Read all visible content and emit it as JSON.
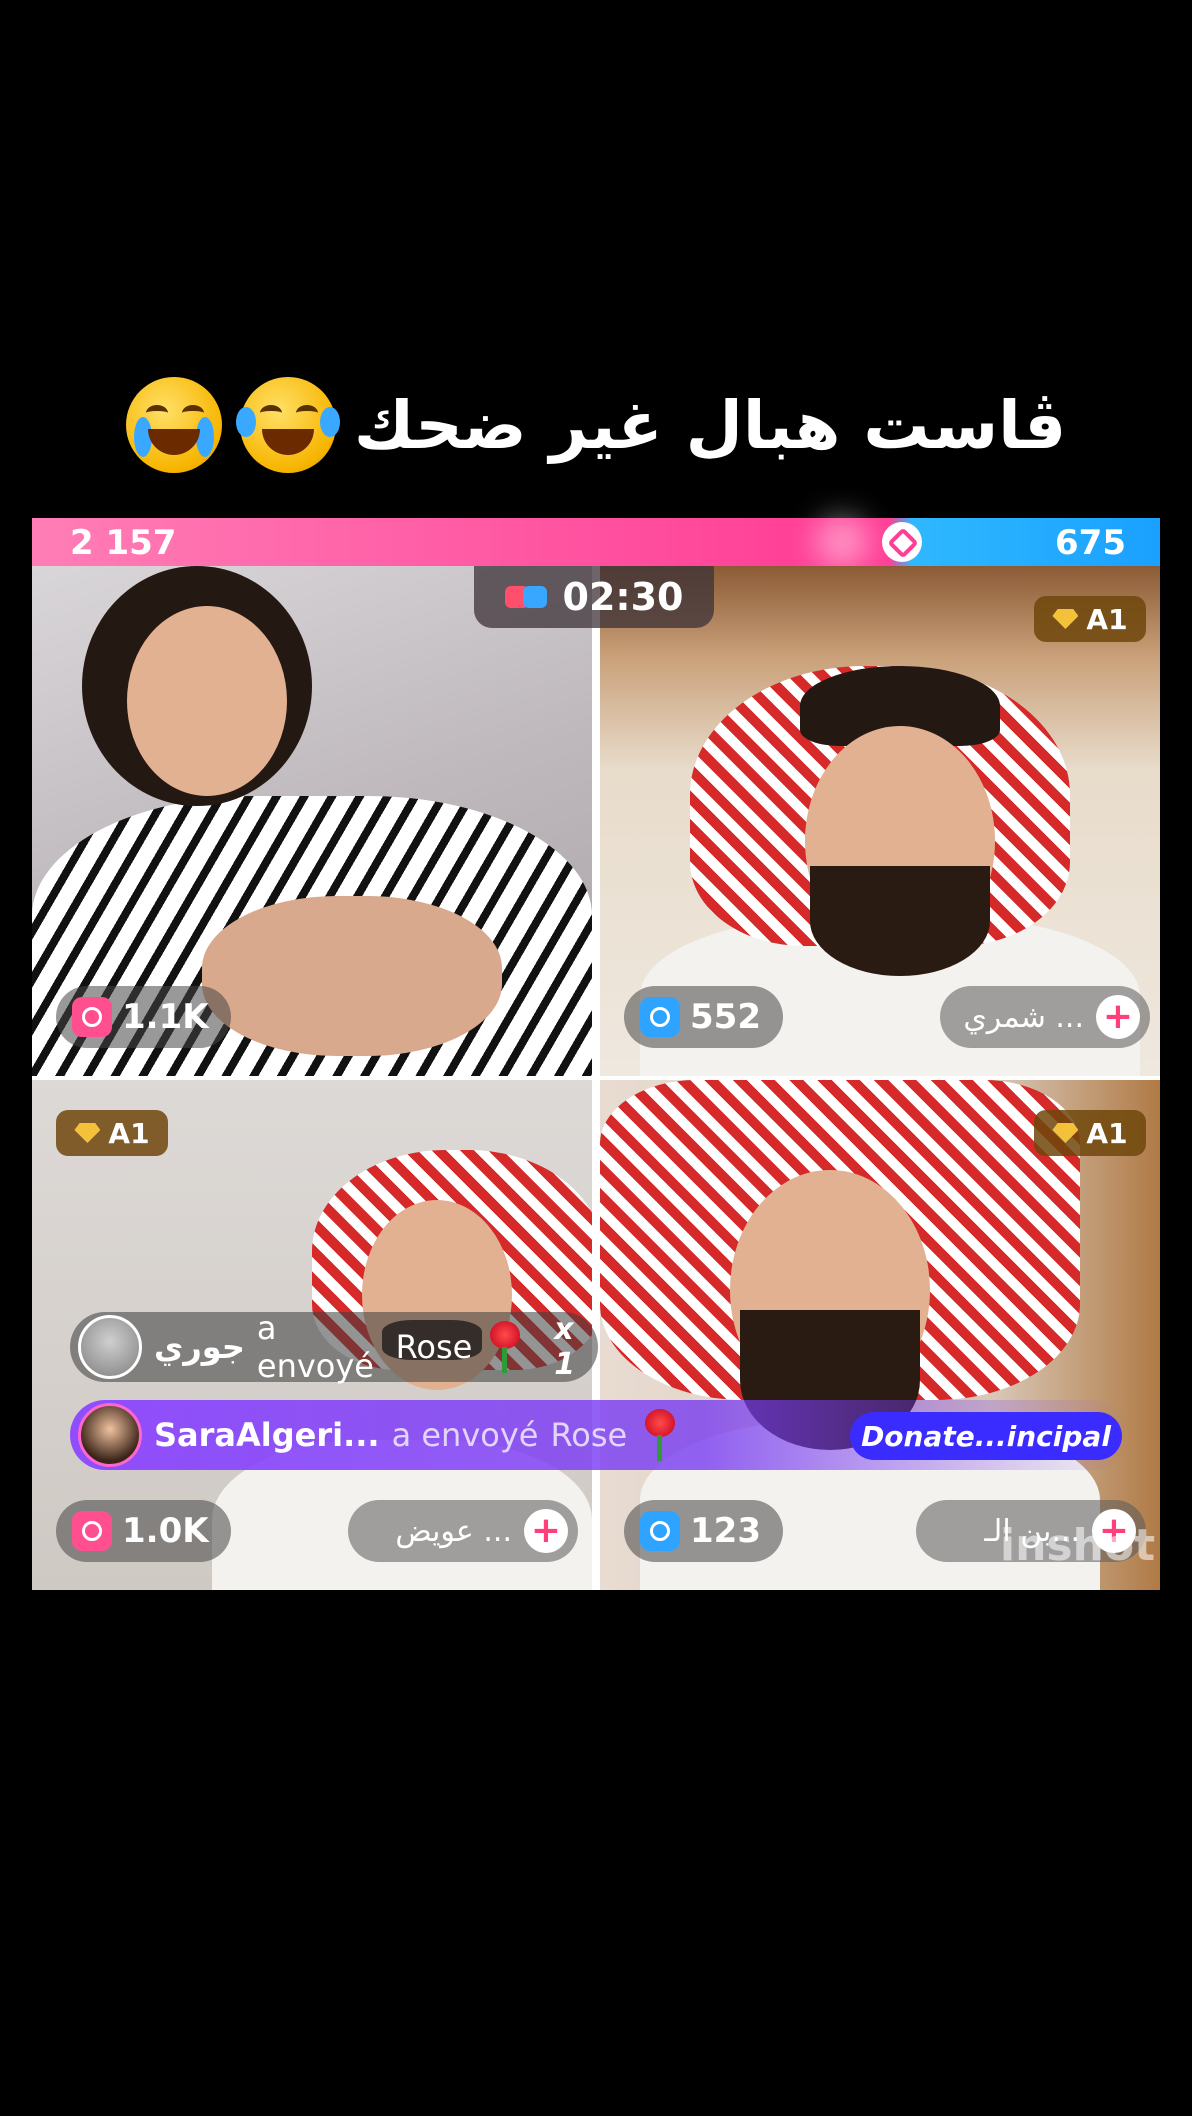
{
  "caption": {
    "text": "ڤاست هبال غير ضحك",
    "emojis": [
      "loudly-crying-face-icon",
      "face-with-tears-of-joy-icon"
    ]
  },
  "pk": {
    "left_score": "2 157",
    "right_score": "675",
    "left_color": "#ff3f96",
    "right_color": "#1aa0ff",
    "timer": "02:30"
  },
  "tiles": [
    {
      "score": "1.1K",
      "score_icon": "pink-clock-icon"
    },
    {
      "badge": "A1",
      "score": "552",
      "score_icon": "blue-clock-icon",
      "follow_name": "شمري ..."
    },
    {
      "badge": "A1",
      "score": "1.0K",
      "score_icon": "pink-clock-icon",
      "follow_name": "عويض ..."
    },
    {
      "badge": "A1",
      "score": "123",
      "score_icon": "blue-clock-icon",
      "follow_name": "بن الـ..."
    }
  ],
  "gifts": [
    {
      "sender": "جوري",
      "action": "a envoyé",
      "gift": "Rose",
      "multiplier": "x 1"
    },
    {
      "sender": "SaraAlgeri...",
      "action": "a envoyé",
      "gift": "Rose"
    }
  ],
  "donate_label": "Donate...incipal",
  "watermark": "inshot",
  "plus_label": "+"
}
